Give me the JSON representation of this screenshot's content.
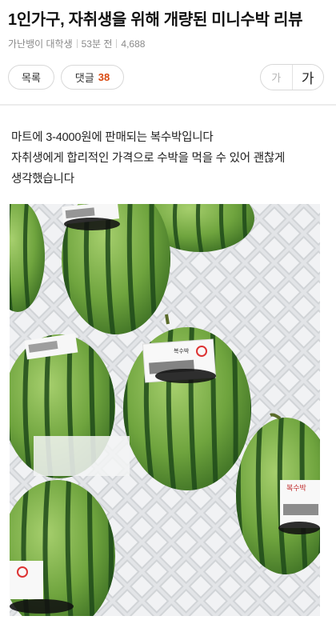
{
  "post": {
    "title": "1인가구, 자취생을 위해 개량된 미니수박 리뷰",
    "author": "가난뱅이 대학생",
    "time": "53분 전",
    "views": "4,688"
  },
  "actions": {
    "list_label": "목록",
    "comment_label": "댓글",
    "comment_count": "38",
    "font_small": "가",
    "font_large": "가"
  },
  "body": {
    "lines": [
      "마트에 3-4000원에 판매되는 복수박입니다",
      "자취생에게 합리적인 가격으로 수박을 먹을 수 있어 괜찮게",
      "생각했습니다"
    ]
  },
  "photo": {
    "label_text_1": "복수박",
    "label_text_2": "복수박"
  },
  "colors": {
    "accent": "#d9480f",
    "watermelon_green": "#5f9a36",
    "stripe": "#1f4a1a"
  }
}
